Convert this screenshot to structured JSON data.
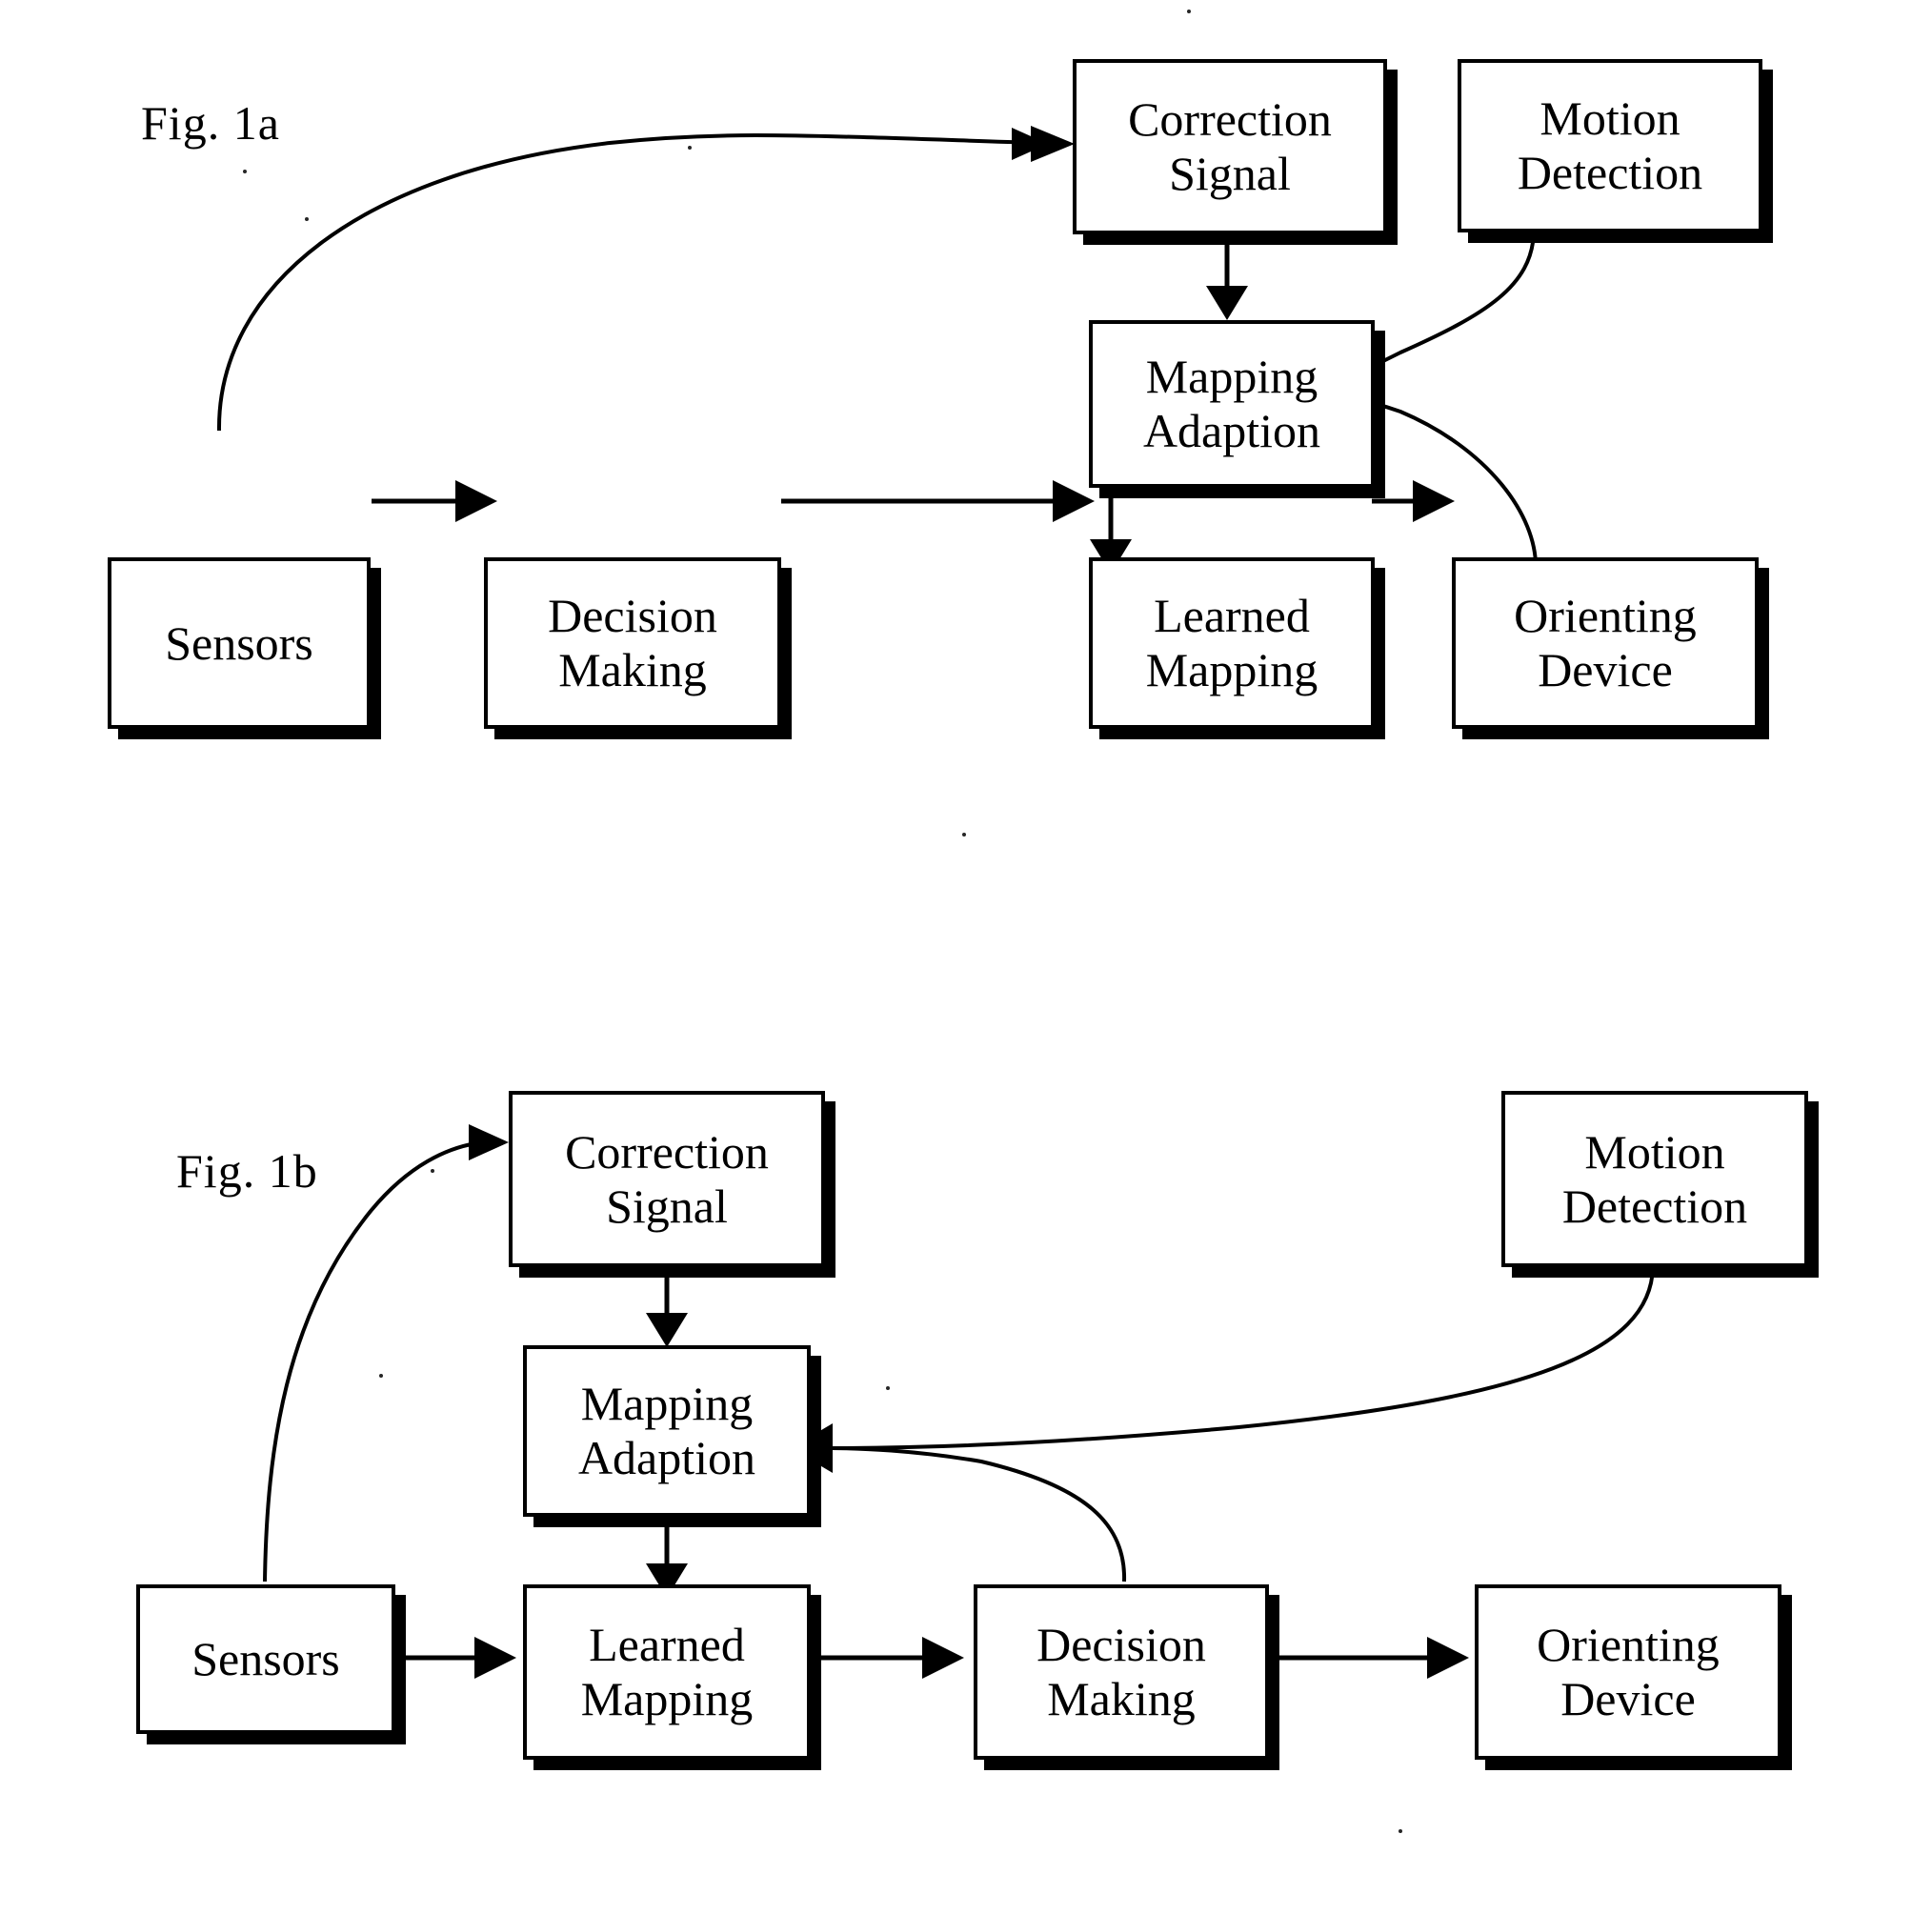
{
  "figures": [
    {
      "id": "fig-1a",
      "label": "Fig. 1a",
      "nodes": [
        {
          "id": "correction-signal",
          "lines": [
            "Correction",
            "Signal"
          ]
        },
        {
          "id": "motion-detection",
          "lines": [
            "Motion",
            "Detection"
          ]
        },
        {
          "id": "mapping-adaption",
          "lines": [
            "Mapping",
            "Adaption"
          ]
        },
        {
          "id": "sensors",
          "lines": [
            "Sensors"
          ]
        },
        {
          "id": "decision-making",
          "lines": [
            "Decision",
            "Making"
          ]
        },
        {
          "id": "learned-mapping",
          "lines": [
            "Learned",
            "Mapping"
          ]
        },
        {
          "id": "orienting-device",
          "lines": [
            "Orienting",
            "Device"
          ]
        }
      ],
      "edges": [
        {
          "from": "sensors",
          "to": "correction-signal",
          "style": "curved"
        },
        {
          "from": "correction-signal",
          "to": "mapping-adaption",
          "style": "straight"
        },
        {
          "from": "motion-detection",
          "to": "mapping-adaption",
          "style": "curved"
        },
        {
          "from": "orienting-device",
          "to": "mapping-adaption",
          "style": "curved"
        },
        {
          "from": "mapping-adaption",
          "to": "learned-mapping",
          "style": "straight"
        },
        {
          "from": "sensors",
          "to": "decision-making",
          "style": "straight"
        },
        {
          "from": "decision-making",
          "to": "learned-mapping",
          "style": "straight"
        },
        {
          "from": "learned-mapping",
          "to": "orienting-device",
          "style": "straight"
        }
      ]
    },
    {
      "id": "fig-1b",
      "label": "Fig. 1b",
      "nodes": [
        {
          "id": "correction-signal",
          "lines": [
            "Correction",
            "Signal"
          ]
        },
        {
          "id": "motion-detection",
          "lines": [
            "Motion",
            "Detection"
          ]
        },
        {
          "id": "mapping-adaption",
          "lines": [
            "Mapping",
            "Adaption"
          ]
        },
        {
          "id": "sensors",
          "lines": [
            "Sensors"
          ]
        },
        {
          "id": "learned-mapping",
          "lines": [
            "Learned",
            "Mapping"
          ]
        },
        {
          "id": "decision-making",
          "lines": [
            "Decision",
            "Making"
          ]
        },
        {
          "id": "orienting-device",
          "lines": [
            "Orienting",
            "Device"
          ]
        }
      ],
      "edges": [
        {
          "from": "sensors",
          "to": "correction-signal",
          "style": "curved"
        },
        {
          "from": "correction-signal",
          "to": "mapping-adaption",
          "style": "straight"
        },
        {
          "from": "motion-detection",
          "to": "mapping-adaption",
          "style": "curved"
        },
        {
          "from": "decision-making",
          "to": "mapping-adaption",
          "style": "curved"
        },
        {
          "from": "mapping-adaption",
          "to": "learned-mapping",
          "style": "straight"
        },
        {
          "from": "sensors",
          "to": "learned-mapping",
          "style": "straight"
        },
        {
          "from": "learned-mapping",
          "to": "decision-making",
          "style": "straight"
        },
        {
          "from": "decision-making",
          "to": "orienting-device",
          "style": "straight"
        }
      ]
    }
  ],
  "colors": {
    "ink": "#000000",
    "paper": "#ffffff",
    "shadow": "#000000"
  }
}
